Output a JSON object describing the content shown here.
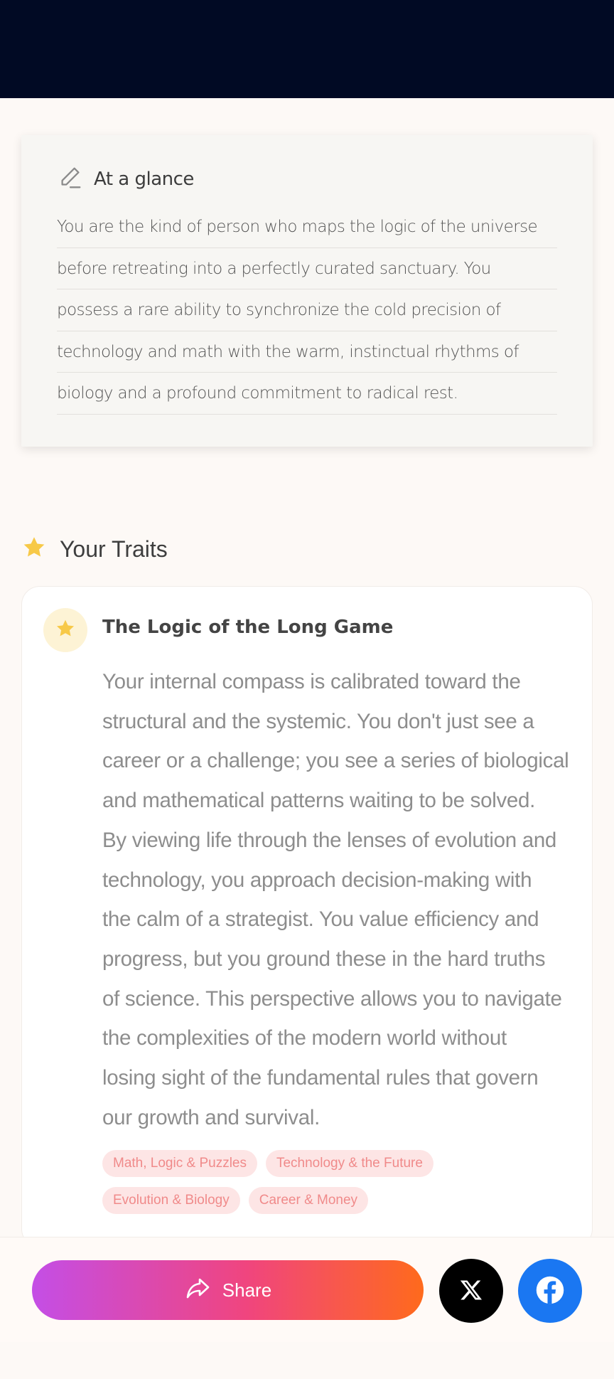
{
  "glance": {
    "title": "At a glance",
    "icon": "pencil-icon",
    "lines": [
      "You are the kind of person who maps the logic of the universe",
      "before retreating into a perfectly curated sanctuary. You",
      "possess a rare ability to synchronize the cold precision of",
      "technology and math with the warm, instinctual rhythms of",
      "biology and a profound commitment to radical rest."
    ]
  },
  "traits": {
    "heading": "Your Traits",
    "icon": "star-icon",
    "items": [
      {
        "title": "The Logic of the Long Game",
        "icon": "star-icon",
        "body_lines": [
          "Your internal compass is calibrated toward the",
          "structural and the systemic. You don't just see a",
          "career or a challenge; you see a series of biological",
          "and mathematical patterns waiting to be solved.",
          "By viewing life through the lenses of evolution and",
          "technology, you approach decision-making with",
          "the calm of a strategist. You value efficiency and",
          "progress, but you ground these in the hard truths",
          "of science. This perspective allows you to navigate",
          "the complexities of the modern world without",
          "losing sight of the fundamental rules that govern",
          "our growth and survival."
        ],
        "tags": [
          "Math, Logic & Puzzles",
          "Technology & the Future",
          "Evolution & Biology",
          "Career & Money"
        ]
      }
    ]
  },
  "share_bar": {
    "share_label": "Share",
    "share_icon": "share-arrow-icon",
    "x_icon": "x-logo-icon",
    "facebook_icon": "facebook-logo-icon"
  },
  "colors": {
    "top_bar": "#010a24",
    "star": "#f7c948",
    "tag_bg": "#fde5e5",
    "tag_text": "#f08a8a",
    "facebook": "#1a77f2",
    "share_gradient": [
      "#c44ee6",
      "#f0457e",
      "#ff6a1c"
    ]
  }
}
